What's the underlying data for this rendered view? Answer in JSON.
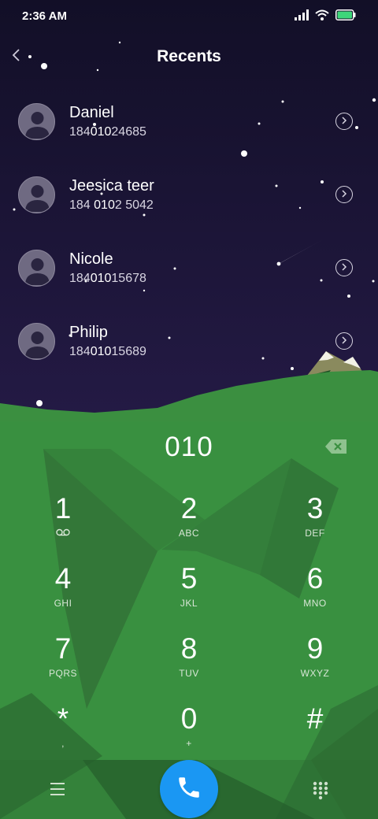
{
  "status": {
    "time": "2:36 AM",
    "icons": [
      "signal-icon",
      "wifi-icon",
      "battery-icon"
    ],
    "battery_color": "#3ed67a"
  },
  "header": {
    "title": "Recents",
    "back_icon": "chevron-left-icon"
  },
  "recents": [
    {
      "name": "Daniel",
      "number_pre": "184",
      "number_match": "010",
      "number_post": "24685"
    },
    {
      "name": "Jeesica teer",
      "number_pre": "184 ",
      "number_match": "010",
      "number_post": "2 5042"
    },
    {
      "name": "Nicole",
      "number_pre": "184",
      "number_match": "010",
      "number_post": "15678"
    },
    {
      "name": "Philip",
      "number_pre": "184",
      "number_match": "010",
      "number_post": "15689"
    }
  ],
  "dialer": {
    "input_value": "010",
    "backspace_icon": "backspace-icon"
  },
  "keypad": [
    {
      "digit": "1",
      "letters": "",
      "icon": "voicemail-icon"
    },
    {
      "digit": "2",
      "letters": "ABC"
    },
    {
      "digit": "3",
      "letters": "DEF"
    },
    {
      "digit": "4",
      "letters": "GHI"
    },
    {
      "digit": "5",
      "letters": "JKL"
    },
    {
      "digit": "6",
      "letters": "MNO"
    },
    {
      "digit": "7",
      "letters": "PQRS"
    },
    {
      "digit": "8",
      "letters": "TUV"
    },
    {
      "digit": "9",
      "letters": "WXYZ"
    },
    {
      "digit": "*",
      "letters": ","
    },
    {
      "digit": "0",
      "letters": "+"
    },
    {
      "digit": "#",
      "letters": ""
    }
  ],
  "bottom_bar": {
    "menu_icon": "menu-icon",
    "call_icon": "phone-icon",
    "dialpad_icon": "dialpad-icon",
    "call_button_color": "#1a97f3"
  },
  "colors": {
    "sky": "#17122e",
    "grass": "#3a8f3f"
  }
}
